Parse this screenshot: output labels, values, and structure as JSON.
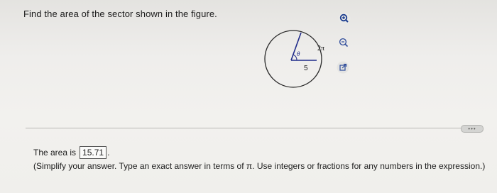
{
  "question": {
    "text": "Find the area of the sector shown in the figure."
  },
  "figure": {
    "angle_label": "θ",
    "arc_label": "2π",
    "radius_label": "5"
  },
  "tools": {
    "zoom_in_icon": "zoom-in-icon",
    "zoom_out_icon": "zoom-out-icon",
    "popout_icon": "popout-icon"
  },
  "more_button": {
    "label": "•••"
  },
  "answer": {
    "prefix": "The area is",
    "value": "15.71",
    "suffix": "."
  },
  "instruction": {
    "text": "(Simplify your answer. Type an exact answer in terms of π. Use integers or fractions for any numbers in the expression.)"
  },
  "colors": {
    "figure_line": "#1f2a8a",
    "circle": "#2a2a2a",
    "tool_blue": "#2c4a9a"
  }
}
